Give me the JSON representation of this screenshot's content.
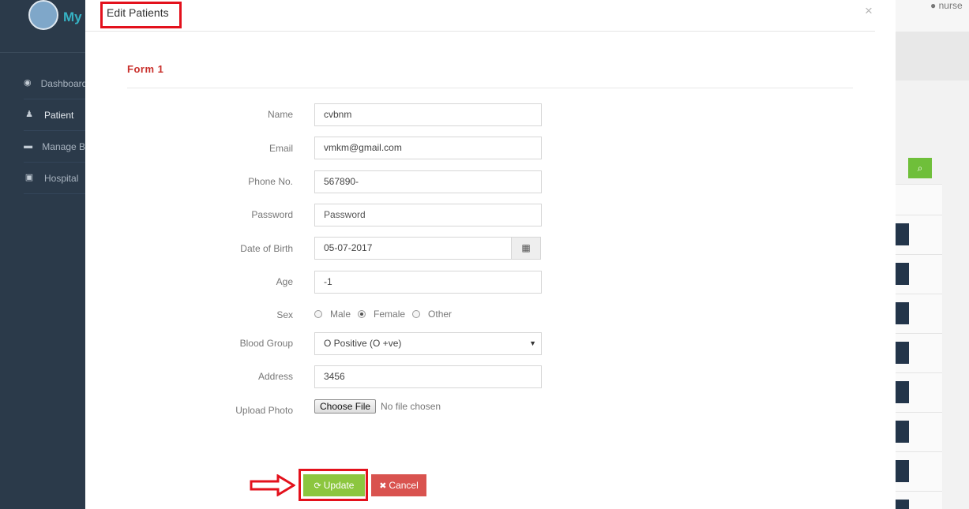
{
  "background": {
    "brand": "My",
    "user": "nurse",
    "nav": [
      {
        "label": "Dashboard",
        "icon": "dashboard-icon",
        "active": false
      },
      {
        "label": "Patient",
        "icon": "patient-icon",
        "active": true
      },
      {
        "label": "Manage B",
        "icon": "bed-icon",
        "active": false
      },
      {
        "label": "Hospital",
        "icon": "hospital-icon",
        "active": false
      }
    ]
  },
  "modal": {
    "title": "Edit Patients",
    "close": "×",
    "form_title": "Form 1",
    "fields": {
      "name": {
        "label": "Name",
        "value": "cvbnm"
      },
      "email": {
        "label": "Email",
        "value": "vmkm@gmail.com"
      },
      "phone": {
        "label": "Phone No.",
        "value": "567890-"
      },
      "password": {
        "label": "Password",
        "placeholder": "Password"
      },
      "dob": {
        "label": "Date of Birth",
        "value": "05-07-2017"
      },
      "age": {
        "label": "Age",
        "value": "-1"
      },
      "sex": {
        "label": "Sex",
        "options": [
          "Male",
          "Female",
          "Other"
        ],
        "selected": "Female"
      },
      "blood_group": {
        "label": "Blood Group",
        "value": "O Positive (O +ve)"
      },
      "address": {
        "label": "Address",
        "value": "3456"
      },
      "photo": {
        "label": "Upload Photo",
        "button": "Choose File",
        "status": "No file chosen"
      }
    },
    "buttons": {
      "update": "Update",
      "cancel": "Cancel"
    }
  },
  "colors": {
    "annotation": "#e3111c",
    "update_bg": "#8cc63f",
    "cancel_bg": "#d9534f",
    "form_title": "#c9302c",
    "sidebar_bg": "#2b3a4a"
  }
}
